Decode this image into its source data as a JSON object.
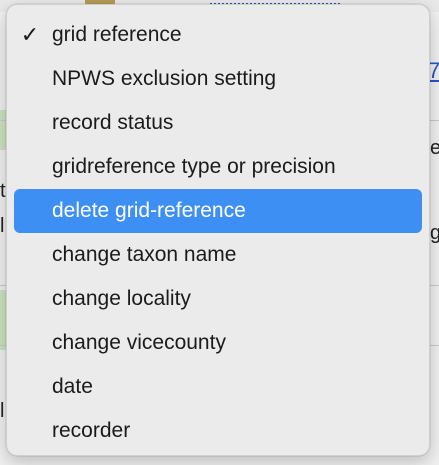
{
  "menu": {
    "items": [
      {
        "label": "grid reference",
        "checked": true,
        "highlighted": false
      },
      {
        "label": "NPWS exclusion setting",
        "checked": false,
        "highlighted": false
      },
      {
        "label": "record status",
        "checked": false,
        "highlighted": false
      },
      {
        "label": "gridreference type or precision",
        "checked": false,
        "highlighted": false
      },
      {
        "label": "delete grid-reference",
        "checked": false,
        "highlighted": true
      },
      {
        "label": "change taxon name",
        "checked": false,
        "highlighted": false
      },
      {
        "label": "change locality",
        "checked": false,
        "highlighted": false
      },
      {
        "label": "change vicecounty",
        "checked": false,
        "highlighted": false
      },
      {
        "label": "date",
        "checked": false,
        "highlighted": false
      },
      {
        "label": "recorder",
        "checked": false,
        "highlighted": false
      }
    ],
    "check_glyph": "✓",
    "highlight_color": "#3d8ff3"
  },
  "background": {
    "right_link_fragment": "7",
    "right_text_fragment_1": "e",
    "right_text_fragment_2": "g",
    "left_fragment_1": "t",
    "left_fragment_2": "l",
    "left_fragment_3": "l"
  }
}
